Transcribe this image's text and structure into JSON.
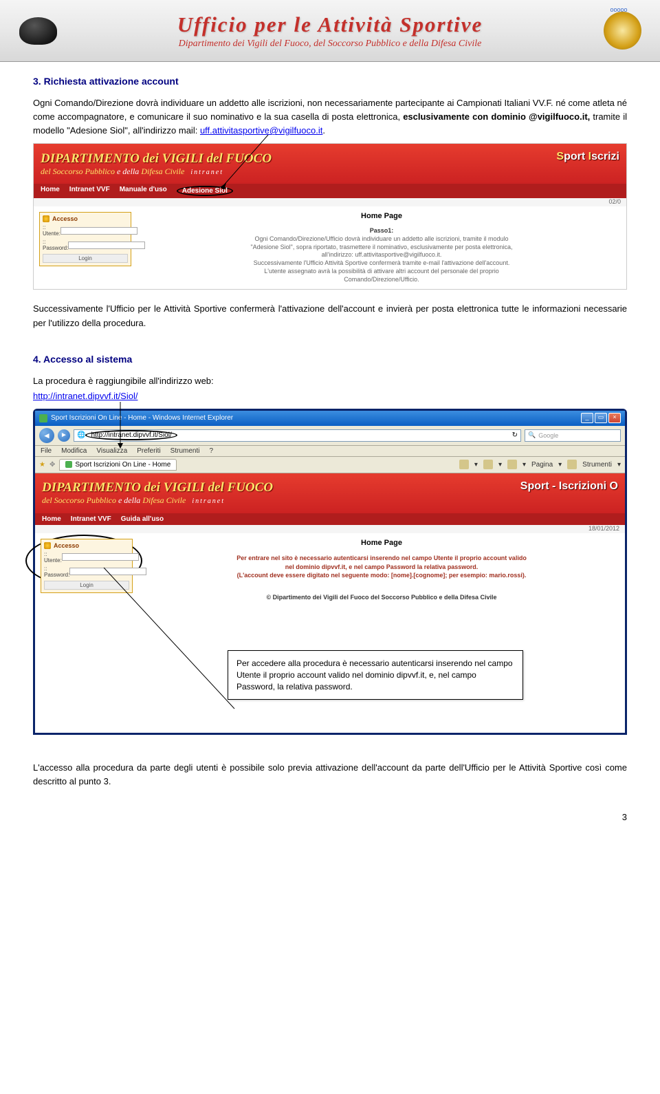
{
  "header": {
    "title": "Ufficio per le Attività Sportive",
    "subtitle": "Dipartimento dei Vigili del Fuoco, del Soccorso Pubblico e della Difesa Civile"
  },
  "section3": {
    "heading": "3.  Richiesta attivazione account",
    "para1a": "Ogni Comando/Direzione dovrà individuare un addetto alle iscrizioni, non necessariamente partecipante ai Campionati Italiani VV.F. né come atleta né come accompagnatore, e comunicare il suo nominativo e la sua casella di posta elettronica, ",
    "para1b": "esclusivamente con dominio @vigilfuoco.it,",
    "para1c": " tramite il modello \"Adesione Siol\", all'indirizzo mail: ",
    "mail": "uff.attivitasportive@vigilfuoco.it",
    "para1d": ".",
    "para2": "Successivamente l'Ufficio per le Attività Sportive confermerà l'attivazione dell'account e invierà per posta elettronica tutte le informazioni necessarie per l'utilizzo della procedura."
  },
  "section4": {
    "heading": "4.  Accesso al sistema",
    "para1": "La procedura è raggiungibile all'indirizzo web:",
    "url": "http://intranet.dipvvf.it/Siol/"
  },
  "screenshot1": {
    "dip_title": "DIPARTIMENTO dei VIGILI del FUOCO",
    "dip_sub1": "del Soccorso Pubblico",
    "dip_sub_e": " e della ",
    "dip_sub2": "Difesa Civile",
    "right": "Sport Iscrizi",
    "intranet": "intranet",
    "nav_home": "Home",
    "nav_intranet": "Intranet VVF",
    "nav_manuale": "Manuale d'uso",
    "nav_adesione": "Adesione Siol",
    "date": "02/0",
    "accesso": "Accesso",
    "utente": ":: Utente:",
    "password": ":: Password:",
    "login": "Login",
    "hp_title": "Home Page",
    "passo_title": "Passo1:",
    "passo_text1": "Ogni Comando/Direzione/Ufficio dovrà individuare un addetto alle iscrizioni, tramite il modulo",
    "passo_text2": "\"Adesione Siol\", sopra riportato, trasmettere il nominativo, esclusivamente per posta elettronica,",
    "passo_text3": "all'indirizzo: uff.attivitasportive@vigilfuoco.it.",
    "passo_text4": "Successivamente l'Ufficio Attività Sportive confermerà tramite e-mail l'attivazione dell'account.",
    "passo_text5": "L'utente assegnato avrà la possibilità di attivare altri account del personale del proprio",
    "passo_text6": "Comando/Direzione/Ufficio."
  },
  "screenshot2": {
    "window_title": "Sport Iscrizioni On Line - Home - Windows Internet Explorer",
    "addr": "http://intranet.dipvvf.it/Siol/",
    "search_placeholder": "Google",
    "menu_file": "File",
    "menu_modifica": "Modifica",
    "menu_visualizza": "Visualizza",
    "menu_preferiti": "Preferiti",
    "menu_strumenti": "Strumenti",
    "menu_help": "?",
    "tab": "Sport Iscrizioni On Line - Home",
    "tool_pagina": "Pagina",
    "tool_strumenti": "Strumenti",
    "dip_title": "DIPARTIMENTO dei VIGILI del FUOCO",
    "dip_sub1": "del Soccorso Pubblico",
    "dip_sub_e": " e della ",
    "dip_sub2": "Difesa Civile",
    "right": "Sport - Iscrizioni O",
    "intranet": "intranet",
    "nav_home": "Home",
    "nav_intranet": "Intranet VVF",
    "nav_guida": "Guida all'uso",
    "date": "18/01/2012",
    "accesso": "Accesso",
    "utente": ":: Utente:",
    "password": ":: Password:",
    "login": "Login",
    "hp_title": "Home Page",
    "login_text1": "Per entrare nel sito è necessario autenticarsi inserendo nel campo Utente il proprio account valido",
    "login_text2": "nel dominio dipvvf.it, e nel campo Password la relativa password.",
    "login_text3": "(L'account deve essere digitato nel seguente modo: [nome].[cognome]; per esempio: mario.rossi).",
    "copyright": "© Dipartimento dei Vigili del Fuoco del Soccorso Pubblico e della Difesa Civile"
  },
  "callout": {
    "text": "Per accedere alla procedura è necessario autenticarsi inserendo nel campo Utente il proprio account valido nel dominio dipvvf.it, e, nel campo Password, la relativa password."
  },
  "footer": {
    "para": "L'accesso alla procedura da parte degli utenti è possibile solo previa attivazione dell'account da parte dell'Ufficio per le Attività Sportive così come descritto al punto 3.",
    "page_num": "3"
  }
}
